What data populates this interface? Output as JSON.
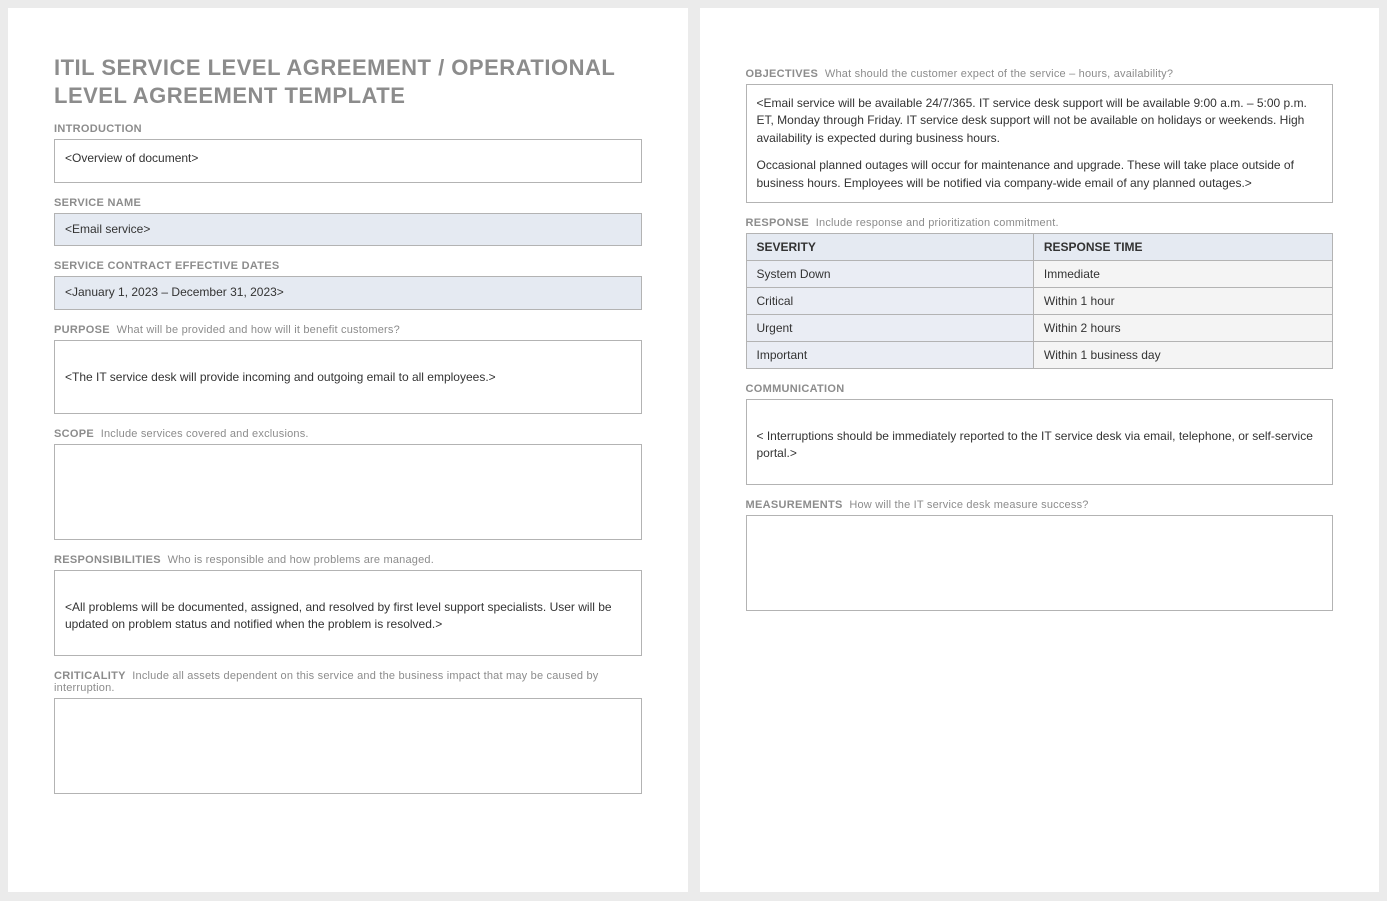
{
  "left": {
    "title": "ITIL SERVICE LEVEL AGREEMENT / OPERATIONAL LEVEL AGREEMENT TEMPLATE",
    "introduction": {
      "label": "INTRODUCTION",
      "value": "<Overview of document>"
    },
    "serviceName": {
      "label": "SERVICE NAME",
      "value": "<Email service>"
    },
    "dates": {
      "label": "SERVICE CONTRACT EFFECTIVE DATES",
      "value": "<January 1, 2023 – December 31, 2023>"
    },
    "purpose": {
      "label": "PURPOSE",
      "hint": "What will be provided and how will it benefit customers?",
      "value": "<The IT service desk will provide incoming and outgoing email to all employees.>"
    },
    "scope": {
      "label": "SCOPE",
      "hint": "Include services covered and exclusions.",
      "value": ""
    },
    "responsibilities": {
      "label": "RESPONSIBILITIES",
      "hint": "Who is responsible and how problems are managed.",
      "value": "<All problems will be documented, assigned, and resolved by first level support specialists. User will be updated on problem status and notified when the problem is resolved.>"
    },
    "criticality": {
      "label": "CRITICALITY",
      "hint": "Include all assets dependent on this service and the business impact that may be caused by interruption.",
      "value": ""
    }
  },
  "right": {
    "objectives": {
      "label": "OBJECTIVES",
      "hint": "What should the customer expect of the service – hours, availability?",
      "para1": "<Email service will be available 24/7/365. IT service desk support will be available 9:00 a.m. – 5:00 p.m. ET, Monday through Friday. IT service desk support will not be available on holidays or weekends. High availability is expected during business hours.",
      "para2": "Occasional planned outages will occur for maintenance and upgrade. These will take place outside of business hours. Employees will be notified via company-wide email of any planned outages.>"
    },
    "response": {
      "label": "RESPONSE",
      "hint": "Include response and prioritization commitment.",
      "headers": {
        "severity": "SEVERITY",
        "time": "RESPONSE TIME"
      },
      "rows": [
        {
          "severity": "System Down",
          "time": "Immediate"
        },
        {
          "severity": "Critical",
          "time": "Within 1 hour"
        },
        {
          "severity": "Urgent",
          "time": "Within 2 hours"
        },
        {
          "severity": "Important",
          "time": "Within 1 business day"
        }
      ]
    },
    "communication": {
      "label": "COMMUNICATION",
      "value": "< Interruptions should be immediately reported to the IT service desk via email, telephone, or self-service portal.>"
    },
    "measurements": {
      "label": "MEASUREMENTS",
      "hint": "How will the IT service desk measure success?",
      "value": ""
    }
  }
}
